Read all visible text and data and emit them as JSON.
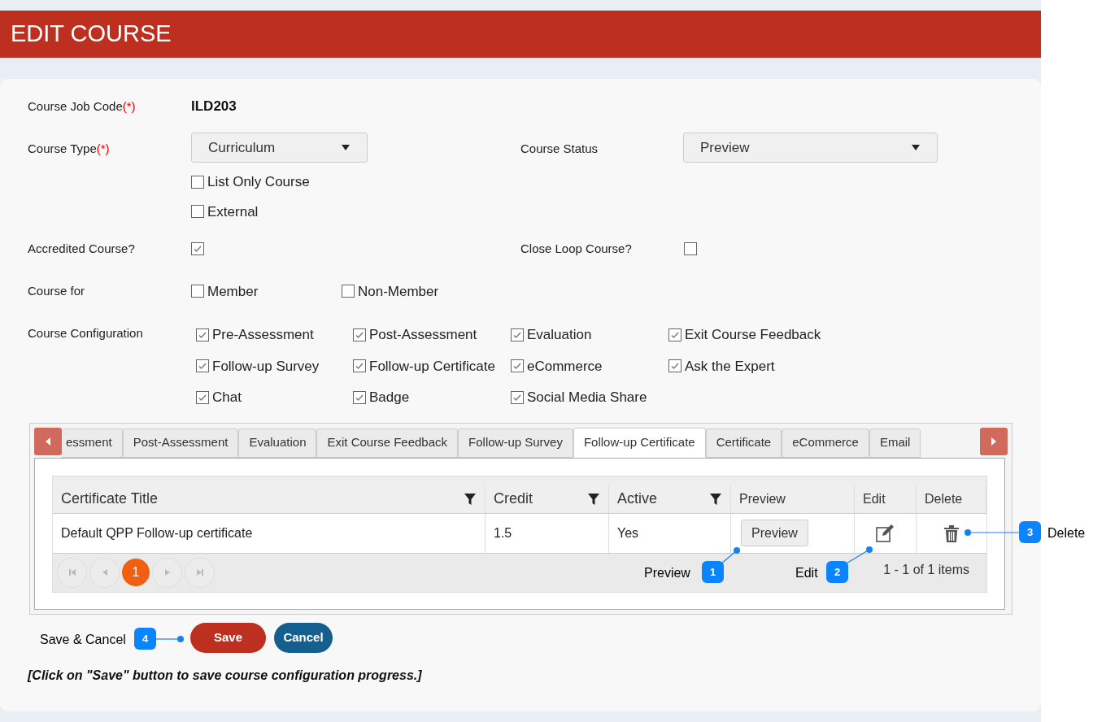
{
  "header": {
    "title": "EDIT COURSE"
  },
  "form": {
    "job_code": {
      "label": "Course Job Code",
      "required_mark": "(*)",
      "value": "ILD203"
    },
    "course_type": {
      "label": "Course Type",
      "required_mark": "(*)",
      "value": "Curriculum",
      "options": [
        {
          "label": "List Only Course",
          "checked": false
        },
        {
          "label": "External",
          "checked": false
        }
      ]
    },
    "course_status": {
      "label": "Course Status",
      "value": "Preview"
    },
    "accredited": {
      "label": "Accredited Course?",
      "checked": true
    },
    "close_loop": {
      "label": "Close Loop Course?",
      "checked": false
    },
    "course_for": {
      "label": "Course for",
      "options": [
        {
          "label": "Member",
          "checked": false
        },
        {
          "label": "Non-Member",
          "checked": false
        }
      ]
    },
    "configuration": {
      "label": "Course Configuration",
      "options": [
        {
          "label": "Pre-Assessment",
          "checked": true
        },
        {
          "label": "Post-Assessment",
          "checked": true
        },
        {
          "label": "Evaluation",
          "checked": true
        },
        {
          "label": "Exit Course Feedback",
          "checked": true
        },
        {
          "label": "Follow-up Survey",
          "checked": true
        },
        {
          "label": "Follow-up Certificate",
          "checked": true
        },
        {
          "label": "eCommerce",
          "checked": true
        },
        {
          "label": "Ask the Expert",
          "checked": true
        },
        {
          "label": "Chat",
          "checked": true
        },
        {
          "label": "Badge",
          "checked": true
        },
        {
          "label": "Social Media Share",
          "checked": true
        }
      ]
    }
  },
  "tabs": [
    {
      "label": "essment",
      "selected": false
    },
    {
      "label": "Post-Assessment",
      "selected": false
    },
    {
      "label": "Evaluation",
      "selected": false
    },
    {
      "label": "Exit Course Feedback",
      "selected": false
    },
    {
      "label": "Follow-up Survey",
      "selected": false
    },
    {
      "label": "Follow-up Certificate",
      "selected": true
    },
    {
      "label": "Certificate",
      "selected": false
    },
    {
      "label": "eCommerce",
      "selected": false
    },
    {
      "label": "Email",
      "selected": false
    }
  ],
  "table": {
    "columns": [
      {
        "label": "Certificate Title",
        "filter": true
      },
      {
        "label": "Credit",
        "filter": true
      },
      {
        "label": "Active",
        "filter": true
      },
      {
        "label": "Preview",
        "filter": false
      },
      {
        "label": "Edit",
        "filter": false
      },
      {
        "label": "Delete",
        "filter": false
      }
    ],
    "rows": [
      {
        "title": "Default QPP Follow-up certificate",
        "credit": "1.5",
        "active": "Yes",
        "preview_button": "Preview"
      }
    ],
    "pager": {
      "pages": [
        {
          "label": "1",
          "selected": true
        }
      ],
      "summary": "1 - 1 of 1 items"
    }
  },
  "buttons": [
    {
      "kind": "save",
      "label": "Save"
    },
    {
      "kind": "cancel",
      "label": "Cancel"
    }
  ],
  "note": "[Click on \"Save\" button to save course configuration progress.]",
  "callouts": [
    {
      "number": "1",
      "label": "Preview"
    },
    {
      "number": "2",
      "label": "Edit"
    },
    {
      "number": "3",
      "label": "Delete"
    },
    {
      "number": "4",
      "label": "Save & Cancel"
    }
  ]
}
